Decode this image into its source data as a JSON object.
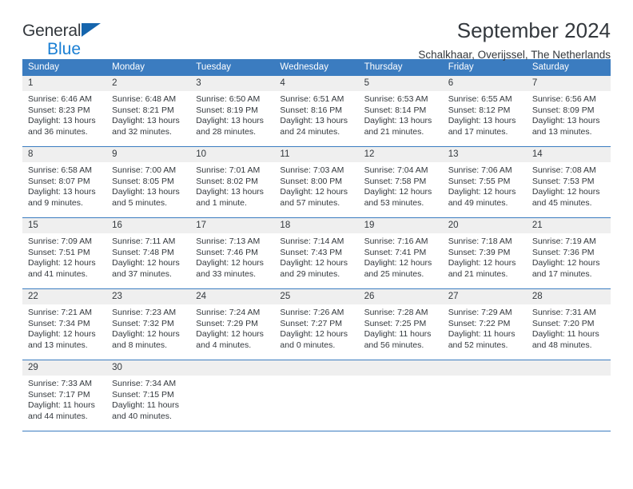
{
  "brand": {
    "name_top": "General",
    "name_bottom": "Blue",
    "logo_icon": "blue-triangle-icon"
  },
  "header": {
    "title": "September 2024",
    "subtitle": "Schalkhaar, Overijssel, The Netherlands"
  },
  "theme": {
    "header_blue": "#3b7cc0",
    "brand_blue": "#1a7fd4",
    "triangle_blue": "#1565ad",
    "day_number_band": "#efefef",
    "text": "#33383d"
  },
  "calendar": {
    "weekdays": [
      "Sunday",
      "Monday",
      "Tuesday",
      "Wednesday",
      "Thursday",
      "Friday",
      "Saturday"
    ],
    "weeks": [
      [
        {
          "day": "1",
          "sunrise": "Sunrise: 6:46 AM",
          "sunset": "Sunset: 8:23 PM",
          "daylight_line1": "Daylight: 13 hours",
          "daylight_line2": "and 36 minutes."
        },
        {
          "day": "2",
          "sunrise": "Sunrise: 6:48 AM",
          "sunset": "Sunset: 8:21 PM",
          "daylight_line1": "Daylight: 13 hours",
          "daylight_line2": "and 32 minutes."
        },
        {
          "day": "3",
          "sunrise": "Sunrise: 6:50 AM",
          "sunset": "Sunset: 8:19 PM",
          "daylight_line1": "Daylight: 13 hours",
          "daylight_line2": "and 28 minutes."
        },
        {
          "day": "4",
          "sunrise": "Sunrise: 6:51 AM",
          "sunset": "Sunset: 8:16 PM",
          "daylight_line1": "Daylight: 13 hours",
          "daylight_line2": "and 24 minutes."
        },
        {
          "day": "5",
          "sunrise": "Sunrise: 6:53 AM",
          "sunset": "Sunset: 8:14 PM",
          "daylight_line1": "Daylight: 13 hours",
          "daylight_line2": "and 21 minutes."
        },
        {
          "day": "6",
          "sunrise": "Sunrise: 6:55 AM",
          "sunset": "Sunset: 8:12 PM",
          "daylight_line1": "Daylight: 13 hours",
          "daylight_line2": "and 17 minutes."
        },
        {
          "day": "7",
          "sunrise": "Sunrise: 6:56 AM",
          "sunset": "Sunset: 8:09 PM",
          "daylight_line1": "Daylight: 13 hours",
          "daylight_line2": "and 13 minutes."
        }
      ],
      [
        {
          "day": "8",
          "sunrise": "Sunrise: 6:58 AM",
          "sunset": "Sunset: 8:07 PM",
          "daylight_line1": "Daylight: 13 hours",
          "daylight_line2": "and 9 minutes."
        },
        {
          "day": "9",
          "sunrise": "Sunrise: 7:00 AM",
          "sunset": "Sunset: 8:05 PM",
          "daylight_line1": "Daylight: 13 hours",
          "daylight_line2": "and 5 minutes."
        },
        {
          "day": "10",
          "sunrise": "Sunrise: 7:01 AM",
          "sunset": "Sunset: 8:02 PM",
          "daylight_line1": "Daylight: 13 hours",
          "daylight_line2": "and 1 minute."
        },
        {
          "day": "11",
          "sunrise": "Sunrise: 7:03 AM",
          "sunset": "Sunset: 8:00 PM",
          "daylight_line1": "Daylight: 12 hours",
          "daylight_line2": "and 57 minutes."
        },
        {
          "day": "12",
          "sunrise": "Sunrise: 7:04 AM",
          "sunset": "Sunset: 7:58 PM",
          "daylight_line1": "Daylight: 12 hours",
          "daylight_line2": "and 53 minutes."
        },
        {
          "day": "13",
          "sunrise": "Sunrise: 7:06 AM",
          "sunset": "Sunset: 7:55 PM",
          "daylight_line1": "Daylight: 12 hours",
          "daylight_line2": "and 49 minutes."
        },
        {
          "day": "14",
          "sunrise": "Sunrise: 7:08 AM",
          "sunset": "Sunset: 7:53 PM",
          "daylight_line1": "Daylight: 12 hours",
          "daylight_line2": "and 45 minutes."
        }
      ],
      [
        {
          "day": "15",
          "sunrise": "Sunrise: 7:09 AM",
          "sunset": "Sunset: 7:51 PM",
          "daylight_line1": "Daylight: 12 hours",
          "daylight_line2": "and 41 minutes."
        },
        {
          "day": "16",
          "sunrise": "Sunrise: 7:11 AM",
          "sunset": "Sunset: 7:48 PM",
          "daylight_line1": "Daylight: 12 hours",
          "daylight_line2": "and 37 minutes."
        },
        {
          "day": "17",
          "sunrise": "Sunrise: 7:13 AM",
          "sunset": "Sunset: 7:46 PM",
          "daylight_line1": "Daylight: 12 hours",
          "daylight_line2": "and 33 minutes."
        },
        {
          "day": "18",
          "sunrise": "Sunrise: 7:14 AM",
          "sunset": "Sunset: 7:43 PM",
          "daylight_line1": "Daylight: 12 hours",
          "daylight_line2": "and 29 minutes."
        },
        {
          "day": "19",
          "sunrise": "Sunrise: 7:16 AM",
          "sunset": "Sunset: 7:41 PM",
          "daylight_line1": "Daylight: 12 hours",
          "daylight_line2": "and 25 minutes."
        },
        {
          "day": "20",
          "sunrise": "Sunrise: 7:18 AM",
          "sunset": "Sunset: 7:39 PM",
          "daylight_line1": "Daylight: 12 hours",
          "daylight_line2": "and 21 minutes."
        },
        {
          "day": "21",
          "sunrise": "Sunrise: 7:19 AM",
          "sunset": "Sunset: 7:36 PM",
          "daylight_line1": "Daylight: 12 hours",
          "daylight_line2": "and 17 minutes."
        }
      ],
      [
        {
          "day": "22",
          "sunrise": "Sunrise: 7:21 AM",
          "sunset": "Sunset: 7:34 PM",
          "daylight_line1": "Daylight: 12 hours",
          "daylight_line2": "and 13 minutes."
        },
        {
          "day": "23",
          "sunrise": "Sunrise: 7:23 AM",
          "sunset": "Sunset: 7:32 PM",
          "daylight_line1": "Daylight: 12 hours",
          "daylight_line2": "and 8 minutes."
        },
        {
          "day": "24",
          "sunrise": "Sunrise: 7:24 AM",
          "sunset": "Sunset: 7:29 PM",
          "daylight_line1": "Daylight: 12 hours",
          "daylight_line2": "and 4 minutes."
        },
        {
          "day": "25",
          "sunrise": "Sunrise: 7:26 AM",
          "sunset": "Sunset: 7:27 PM",
          "daylight_line1": "Daylight: 12 hours",
          "daylight_line2": "and 0 minutes."
        },
        {
          "day": "26",
          "sunrise": "Sunrise: 7:28 AM",
          "sunset": "Sunset: 7:25 PM",
          "daylight_line1": "Daylight: 11 hours",
          "daylight_line2": "and 56 minutes."
        },
        {
          "day": "27",
          "sunrise": "Sunrise: 7:29 AM",
          "sunset": "Sunset: 7:22 PM",
          "daylight_line1": "Daylight: 11 hours",
          "daylight_line2": "and 52 minutes."
        },
        {
          "day": "28",
          "sunrise": "Sunrise: 7:31 AM",
          "sunset": "Sunset: 7:20 PM",
          "daylight_line1": "Daylight: 11 hours",
          "daylight_line2": "and 48 minutes."
        }
      ],
      [
        {
          "day": "29",
          "sunrise": "Sunrise: 7:33 AM",
          "sunset": "Sunset: 7:17 PM",
          "daylight_line1": "Daylight: 11 hours",
          "daylight_line2": "and 44 minutes."
        },
        {
          "day": "30",
          "sunrise": "Sunrise: 7:34 AM",
          "sunset": "Sunset: 7:15 PM",
          "daylight_line1": "Daylight: 11 hours",
          "daylight_line2": "and 40 minutes."
        },
        {
          "day": "",
          "sunrise": "",
          "sunset": "",
          "daylight_line1": "",
          "daylight_line2": ""
        },
        {
          "day": "",
          "sunrise": "",
          "sunset": "",
          "daylight_line1": "",
          "daylight_line2": ""
        },
        {
          "day": "",
          "sunrise": "",
          "sunset": "",
          "daylight_line1": "",
          "daylight_line2": ""
        },
        {
          "day": "",
          "sunrise": "",
          "sunset": "",
          "daylight_line1": "",
          "daylight_line2": ""
        },
        {
          "day": "",
          "sunrise": "",
          "sunset": "",
          "daylight_line1": "",
          "daylight_line2": ""
        }
      ]
    ]
  }
}
